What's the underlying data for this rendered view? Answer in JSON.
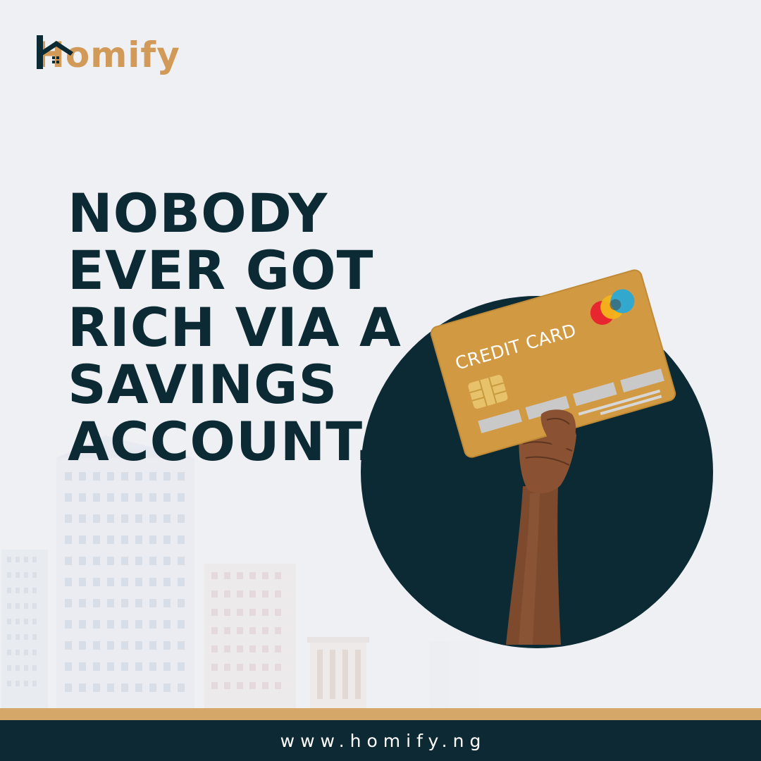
{
  "brand": {
    "name": "Homify",
    "color": "#d19a58",
    "logo_icon": "house-roof-icon"
  },
  "headline": {
    "lines": [
      "NOBODY",
      "EVER GOT",
      "RICH VIA A",
      "SAVINGS",
      "ACCOUNT."
    ],
    "color": "#0c2a34"
  },
  "card": {
    "label": "CREDIT CARD",
    "color": "#d19a42",
    "chip_icon": "card-chip-icon",
    "network_icon": "card-network-circles-icon"
  },
  "footer": {
    "url": "www.homify.ng",
    "background": "#0d2a34",
    "accent": "#d5a86a"
  },
  "colors": {
    "background": "#eff0f3",
    "circle": "#0c2a34",
    "skin": "#8a5232"
  }
}
